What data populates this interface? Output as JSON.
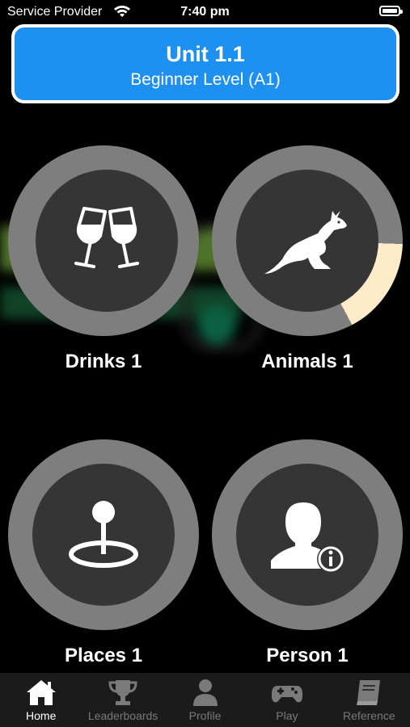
{
  "status_bar": {
    "carrier": "Service Provider",
    "time": "7:40 pm"
  },
  "header": {
    "title": "Unit 1.1",
    "subtitle": "Beginner Level (A1)"
  },
  "lessons": [
    {
      "label": "Drinks 1",
      "icon": "wine-glasses-icon",
      "progress": 0
    },
    {
      "label": "Animals 1",
      "icon": "kangaroo-icon",
      "progress": 0.17
    },
    {
      "label": "Places 1",
      "icon": "location-pin-icon",
      "progress": 0
    },
    {
      "label": "Person 1",
      "icon": "person-info-icon",
      "progress": 0
    }
  ],
  "tabs": [
    {
      "label": "Home",
      "icon": "home-icon",
      "active": true
    },
    {
      "label": "Leaderboards",
      "icon": "trophy-icon",
      "active": false
    },
    {
      "label": "Profile",
      "icon": "person-icon",
      "active": false
    },
    {
      "label": "Play",
      "icon": "gamepad-icon",
      "active": false
    },
    {
      "label": "Reference",
      "icon": "book-icon",
      "active": false
    }
  ],
  "colors": {
    "accent": "#1E90F0",
    "ring": "#7E7E7E",
    "progress": "#FDEBC9",
    "tile_inner": "#353535"
  }
}
